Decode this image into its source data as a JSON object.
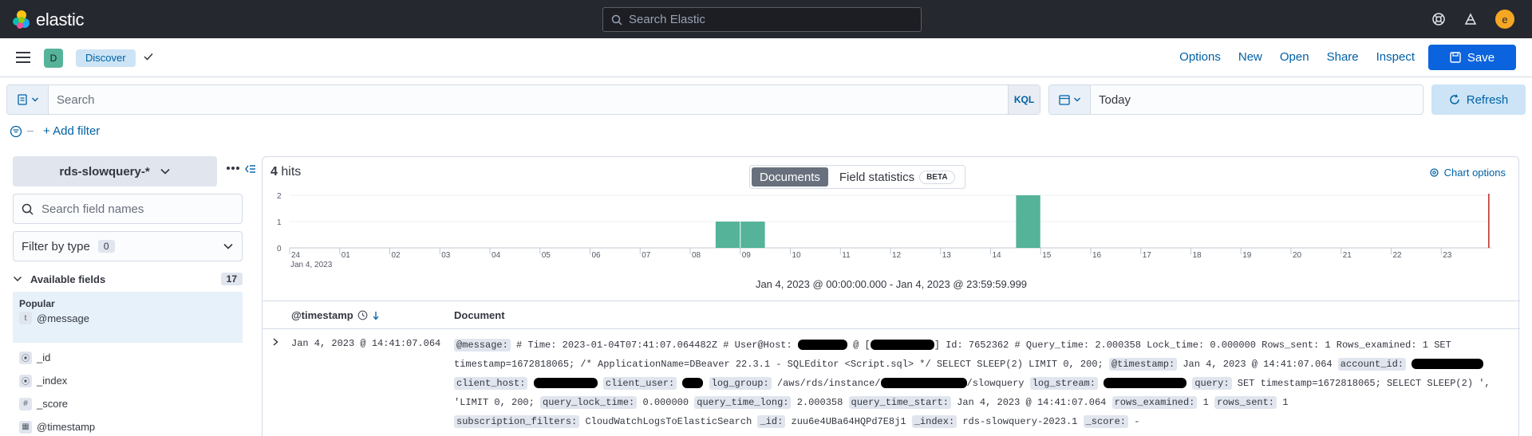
{
  "header": {
    "brand": "elastic",
    "search_placeholder": "Search Elastic",
    "avatar_initial": "e",
    "icons": [
      "help-icon",
      "newsfeed-icon"
    ]
  },
  "appbar": {
    "space_initial": "D",
    "breadcrumb": "Discover",
    "nav": [
      "Options",
      "New",
      "Open",
      "Share",
      "Inspect"
    ],
    "save_label": "Save"
  },
  "query": {
    "placeholder": "Search",
    "language": "KQL",
    "date_value": "Today",
    "refresh_label": "Refresh",
    "add_filter": "+ Add filter"
  },
  "sidebar": {
    "data_view": "rds-slowquery-*",
    "field_search_placeholder": "Search field names",
    "filter_by_type": "Filter by type",
    "filter_count": "0",
    "available_fields": "Available fields",
    "available_count": "17",
    "popular_title": "Popular",
    "popular_fields": [
      {
        "type": "t",
        "name": "@message"
      }
    ],
    "fields": [
      {
        "type": "⦿",
        "name": "_id"
      },
      {
        "type": "⦿",
        "name": "_index"
      },
      {
        "type": "#",
        "name": "_score"
      },
      {
        "type": "▦",
        "name": "@timestamp"
      }
    ]
  },
  "main": {
    "hits_count": "4",
    "hits_label": "hits",
    "tabs": [
      "Documents",
      "Field statistics"
    ],
    "beta": "BETA",
    "chart_options": "Chart options",
    "time_range": "Jan 4, 2023 @ 00:00:00.000 - Jan 4, 2023 @ 23:59:59.999",
    "col_timestamp": "@timestamp",
    "col_document": "Document",
    "row_timestamp": "Jan 4, 2023 @ 14:41:07.064",
    "doc": {
      "message_key": "@message:",
      "message_a": "# Time: 2023-01-04T07:41:07.064482Z # User@Host:",
      "message_b": "@ [",
      "message_c": "] Id: 7652362 # Query_time: 2.000358 Lock_time: 0.000000 Rows_sent: 1 Rows_examined: 1 SET",
      "message_d": "timestamp=1672818065; /* ApplicationName=DBeaver 22.3.1 - SQLEditor <Script.sql> */ SELECT SLEEP(2) LIMIT 0, 200;",
      "timestamp_key": "@timestamp:",
      "timestamp_val": "Jan 4, 2023 @ 14:41:07.064",
      "account_key": "account_id:",
      "client_host_key": "client_host:",
      "client_user_key": "client_user:",
      "log_group_key": "log_group:",
      "log_group_a": "/aws/rds/instance/",
      "log_group_b": "/slowquery",
      "log_stream_key": "log_stream:",
      "query_key": "query:",
      "query_val": "SET timestamp=1672818065; SELECT SLEEP(2) ',",
      "query_cont": "'LIMIT 0, 200;",
      "lock_key": "query_lock_time:",
      "lock_val": "0.000000",
      "long_key": "query_time_long:",
      "long_val": "2.000358",
      "start_key": "query_time_start:",
      "start_val": "Jan 4, 2023 @ 14:41:07.064",
      "examined_key": "rows_examined:",
      "examined_val": "1",
      "sent_key": "rows_sent:",
      "sent_val": "1",
      "subs_key": "subscription_filters:",
      "subs_val": "CloudWatchLogsToElasticSearch",
      "id_key": "_id:",
      "id_val": "zuu6e4UBa64HQPd7E8j1",
      "index_key": "_index:",
      "index_val": "rds-slowquery-2023.1",
      "score_key": "_score:",
      "score_val": "-"
    }
  },
  "chart_data": {
    "type": "bar",
    "x_hours": [
      "24",
      "01",
      "02",
      "03",
      "04",
      "05",
      "06",
      "07",
      "08",
      "09",
      "10",
      "11",
      "12",
      "13",
      "14",
      "15",
      "16",
      "17",
      "18",
      "19",
      "20",
      "21",
      "22",
      "23"
    ],
    "x_date_label": "Jan 4, 2023",
    "y_ticks": [
      "0",
      "1",
      "2"
    ],
    "ylim": [
      0,
      2
    ],
    "bars": [
      {
        "x": 8.5,
        "value": 1
      },
      {
        "x": 9.0,
        "value": 1
      },
      {
        "x": 14.5,
        "value": 2
      }
    ],
    "bar_color": "#54b399",
    "now_marker_color": "#bd271e"
  }
}
